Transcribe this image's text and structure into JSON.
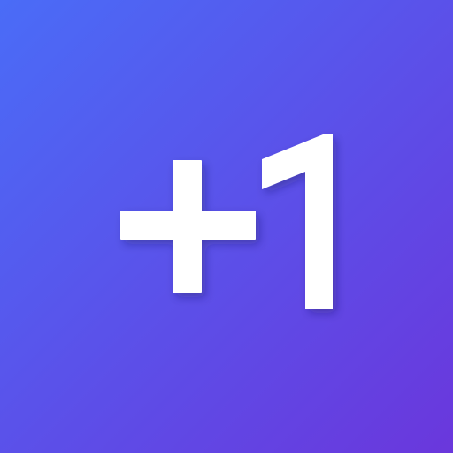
{
  "icon": {
    "name": "plus-one",
    "text": "+1",
    "background_gradient": [
      "#4a6cf7",
      "#5a52ea",
      "#6a37dc"
    ],
    "glyph_color": "#ffffff"
  }
}
